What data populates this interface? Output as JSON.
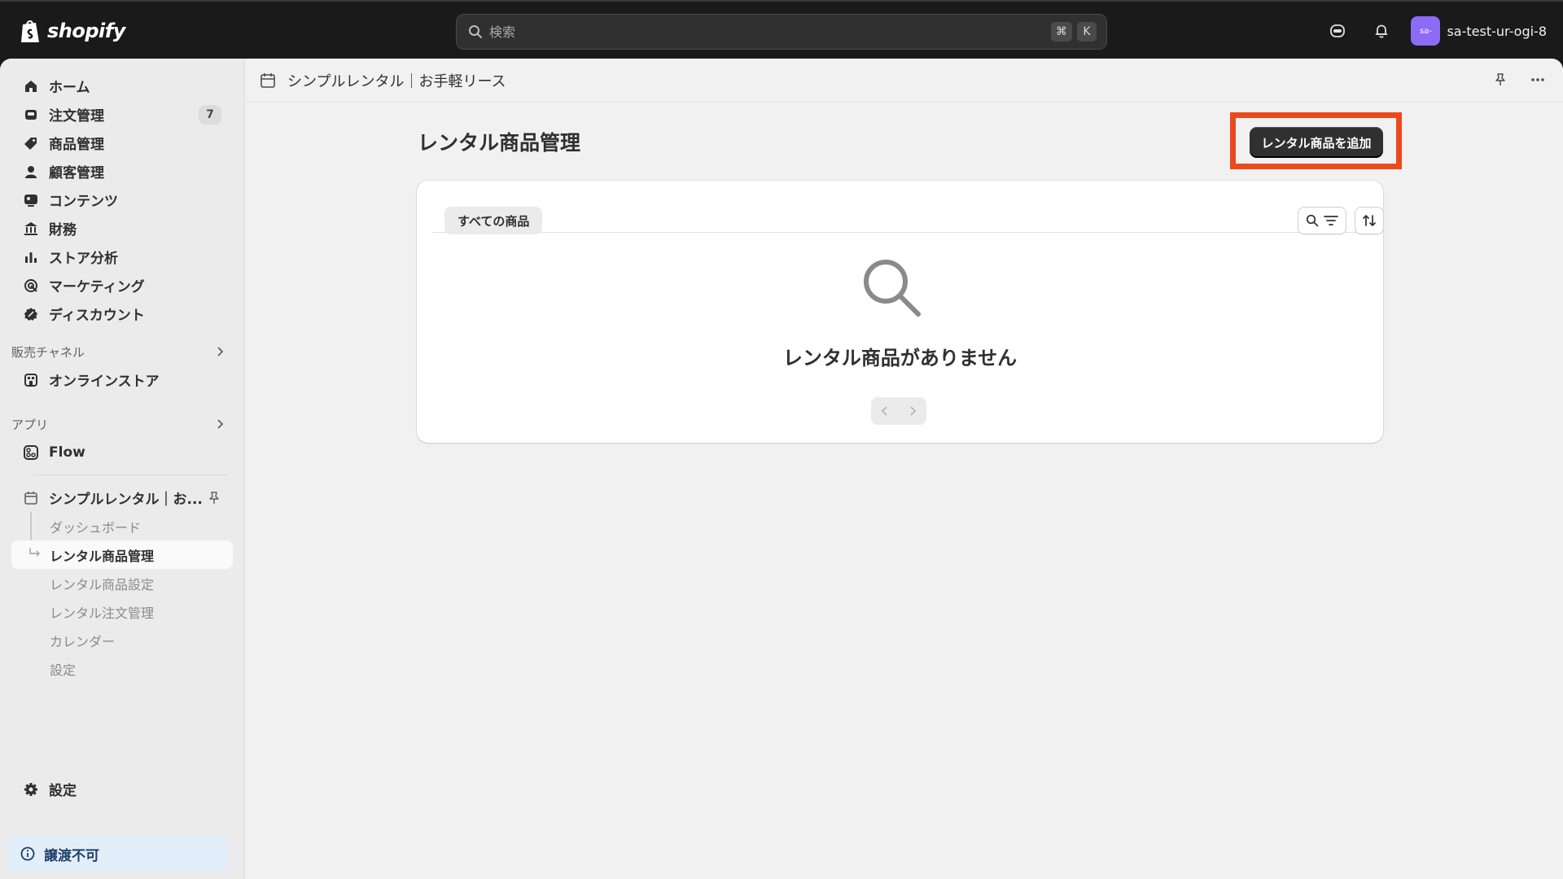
{
  "brand": {
    "logo_text": "shopify"
  },
  "search": {
    "placeholder": "検索",
    "shortcut_cmd": "⌘",
    "shortcut_key": "K"
  },
  "account": {
    "avatar_text": "sa-",
    "store_name": "sa-test-ur-ogi-8",
    "avatar_color": "#8d6bf5"
  },
  "sidebar": {
    "items": [
      {
        "label": "ホーム",
        "icon": "home-icon"
      },
      {
        "label": "注文管理",
        "icon": "inbox-icon",
        "badge": "7"
      },
      {
        "label": "商品管理",
        "icon": "tag-icon"
      },
      {
        "label": "顧客管理",
        "icon": "person-icon"
      },
      {
        "label": "コンテンツ",
        "icon": "content-icon"
      },
      {
        "label": "財務",
        "icon": "bank-icon"
      },
      {
        "label": "ストア分析",
        "icon": "bar-chart-icon"
      },
      {
        "label": "マーケティング",
        "icon": "target-icon"
      },
      {
        "label": "ディスカウント",
        "icon": "discount-icon"
      }
    ],
    "sales_channels": {
      "heading": "販売チャネル",
      "items": [
        {
          "label": "オンラインストア",
          "icon": "store-icon"
        }
      ]
    },
    "apps": {
      "heading": "アプリ",
      "items": [
        {
          "label": "Flow",
          "icon": "flow-icon"
        }
      ]
    },
    "pinned_app": {
      "label": "シンプルレンタル｜お...",
      "sub_items": [
        {
          "label": "ダッシュボード",
          "active": false
        },
        {
          "label": "レンタル商品管理",
          "active": true
        },
        {
          "label": "レンタル商品設定",
          "active": false
        },
        {
          "label": "レンタル注文管理",
          "active": false
        },
        {
          "label": "カレンダー",
          "active": false
        },
        {
          "label": "設定",
          "active": false
        }
      ]
    },
    "settings_label": "設定",
    "notice_label": "譲渡不可"
  },
  "appbar": {
    "title": "シンプルレンタル｜お手軽リース"
  },
  "page": {
    "title": "レンタル商品管理",
    "primary_action": "レンタル商品を追加",
    "highlight_color": "#ec4a1c",
    "tab_all": "すべての商品",
    "empty_state": "レンタル商品がありません"
  }
}
